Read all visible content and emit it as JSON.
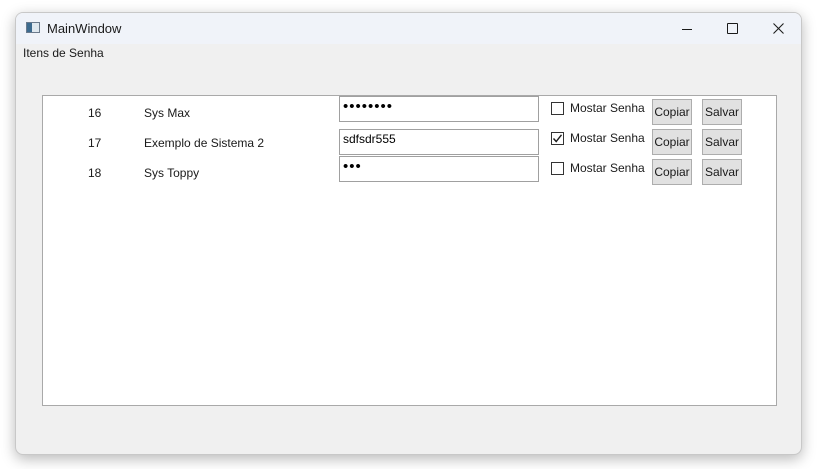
{
  "window": {
    "title": "MainWindow"
  },
  "menu": {
    "item": "Itens de Senha"
  },
  "rows": [
    {
      "id": "16",
      "name": "Sys Max",
      "password_display": "••••••••",
      "show_password": false,
      "checkbox_label": "Mostar Senha",
      "copy_label": "Copiar",
      "save_label": "Salvar"
    },
    {
      "id": "17",
      "name": "Exemplo de Sistema 2",
      "password_display": "sdfsdr555",
      "show_password": true,
      "checkbox_label": "Mostar Senha",
      "copy_label": "Copiar",
      "save_label": "Salvar"
    },
    {
      "id": "18",
      "name": "Sys Toppy",
      "password_display": "•••",
      "show_password": false,
      "checkbox_label": "Mostar Senha",
      "copy_label": "Copiar",
      "save_label": "Salvar"
    }
  ],
  "icons": {
    "app": "app-window-icon",
    "minimize": "minimize-icon",
    "maximize": "maximize-icon",
    "close": "close-icon",
    "check": "checkmark-icon"
  }
}
